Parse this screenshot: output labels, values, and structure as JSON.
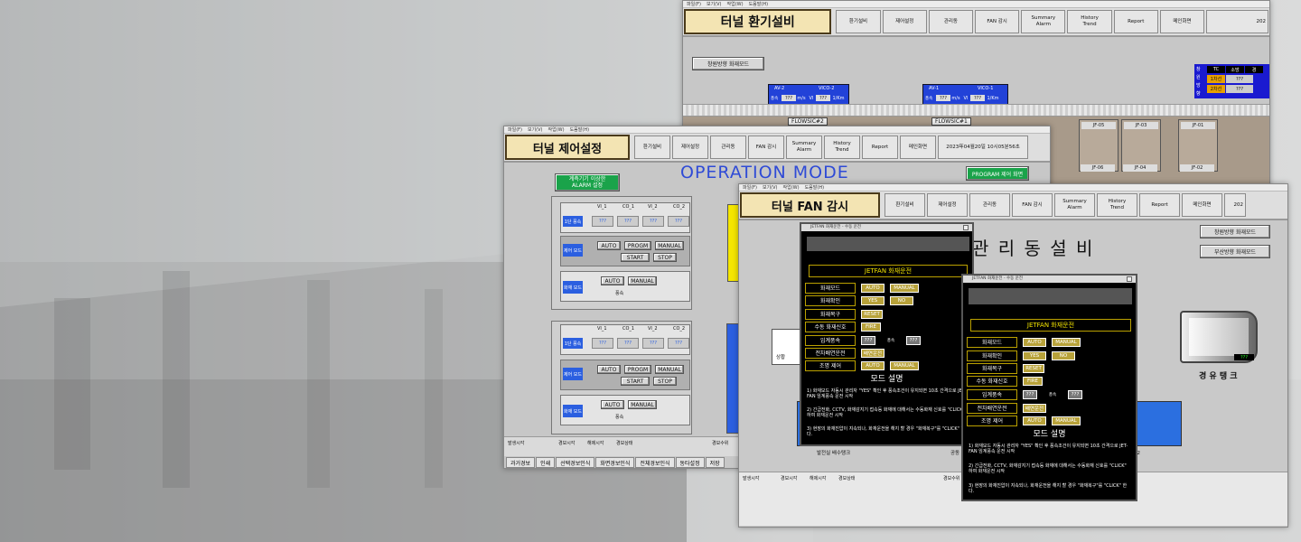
{
  "menu": [
    "파일(F)",
    "보기(V)",
    "작업(W)",
    "도움말(H)"
  ],
  "nav": {
    "items": [
      "환기설비",
      "제어설정",
      "관리동",
      "FAN 감시",
      "Summary\nAlarm",
      "History\nTrend",
      "Report",
      "메인화면"
    ]
  },
  "win_ventilation": {
    "title": "터널 환기설비",
    "clock": "202",
    "fire_mode_btn": "창원방향 화재모드",
    "flow1": "FLOWSIC#2",
    "flow2": "FLOWSIC#1",
    "av1": {
      "name": "AV-2",
      "vico": "VICO-2",
      "vals": [
        "???",
        "m/s",
        "VI",
        "???",
        "1/Km",
        "CO",
        "???",
        "ppm"
      ],
      "labels": [
        "풍속",
        "풍향"
      ]
    },
    "av2": {
      "name": "AV-1",
      "vico": "VICO-1",
      "vals": [
        "???",
        "m/s",
        "VI",
        "???",
        "1/Km",
        "CO",
        "???",
        "ppm"
      ],
      "labels": [
        "풍속",
        "풍향"
      ]
    },
    "side_table": {
      "label": "창원방향",
      "headers": [
        "TC",
        "소방",
        "경"
      ],
      "rows": [
        [
          "1차선",
          "???"
        ],
        [
          "2차선",
          "???"
        ]
      ]
    },
    "fans": [
      "JF-05",
      "JF-03",
      "JF-01",
      "JF-06",
      "JF-04",
      "JF-02"
    ]
  },
  "win_control": {
    "title": "터널 제어설정",
    "clock": "2023年04월20일 10시05분56초",
    "heading": "OPERATION MODE",
    "program_btn": "PROGRAM 제어 화면",
    "alarm_btn": "계측기기 이상한\nALARM 설정",
    "group1": {
      "cols": [
        "VI_1",
        "CO_1",
        "VI_2",
        "CO_2"
      ],
      "cells": [
        "???",
        "???",
        "???",
        "???"
      ],
      "row_label": "1단 풍속",
      "ctrl_label": "제어 모드",
      "ctrl_btns": [
        "AUTO",
        "PROGM",
        "MANUAL"
      ],
      "ctrl_btns2": [
        "START",
        "STOP"
      ],
      "fan_label": "화재 모드",
      "fan_btns": [
        "AUTO",
        "MANUAL"
      ],
      "fan_step": "풍속"
    },
    "group2": {
      "cols": [
        "VI_1",
        "CO_1",
        "VI_2",
        "CO_2"
      ],
      "cells": [
        "???",
        "???",
        "???",
        "???"
      ],
      "row_label": "1단 풍속",
      "ctrl_label": "제어 모드",
      "ctrl_btns": [
        "AUTO",
        "PROGM",
        "MANUAL"
      ],
      "ctrl_btns2": [
        "START",
        "STOP"
      ],
      "fan_label": "화재 모드",
      "fan_btns": [
        "AUTO",
        "MANUAL"
      ],
      "fan_step": "풍속"
    },
    "status_cols": [
      "발생시각",
      "경보시각",
      "해제시각",
      "경보상태",
      "경보수위"
    ],
    "tabs": [
      "과거경보",
      "인쇄",
      "선택경보인식",
      "화면경보인식",
      "전체경보인식",
      "동타설정",
      "저장"
    ]
  },
  "win_fan": {
    "title": "터널 FAN 감시",
    "clock": "202",
    "heading": "관 리 동 설 비",
    "btn_a": "창원방향 화재모드",
    "btn_b": "부산방향 화재모드",
    "tank_label": "경 유 탱 크",
    "tank_value": "???",
    "pump_label": "발전실 배수탱크",
    "pump_label2": "공동",
    "status_cols": [
      "발생시각",
      "경보시각",
      "해제시각",
      "경보상태",
      "경보수위"
    ],
    "right_label": "크 - 2",
    "left_tag": "상황"
  },
  "dialog1": {
    "title": "JETFAN 화재운전 - 수동 운전",
    "heading": "JETFAN 화재운전",
    "rows": [
      {
        "label": "화재모드",
        "btns": [
          "AUTO",
          "MANUAL"
        ]
      },
      {
        "label": "화재확인",
        "btns": [
          "YES",
          "NO"
        ]
      },
      {
        "label": "화재복구",
        "btns": [
          "RESET"
        ]
      },
      {
        "label": "수동 화재신호",
        "btns": [
          "FIRE"
        ]
      },
      {
        "label": "임계풍속",
        "btns": [
          "???",
          "풍속",
          "???"
        ]
      },
      {
        "label": "전차배연운전",
        "btns": [
          "배연운전"
        ]
      },
      {
        "label": "조명 제어",
        "btns": [
          "AUTO",
          "MANUAL"
        ]
      }
    ],
    "mode_heading": "모드 설명",
    "desc": [
      "1) 화재모드 자동시 관리자 \"YES\" 확인 후 풍속조건이 유지되면 10초 간격으로 JET-FAN 임계풍속 운전 시작",
      "2) 긴급전화, CCTV, 화재감지기 접속등 화재에 대해서는 수동화재 신호를 \"CLICK\" 하여 화재운전 시작",
      "3) 현장의 화재진압이 지속되나, 화재운전을 해지 할 경우 \"화재복구\"를 \"CLICK\" 한다."
    ]
  },
  "dialog2": {
    "title": "JETFAN 화재운전 - 수동 운전",
    "heading": "JETFAN 화재운전",
    "rows": [
      {
        "label": "화재모드",
        "btns": [
          "AUTO",
          "MANUAL"
        ]
      },
      {
        "label": "화재확인",
        "btns": [
          "YES",
          "NO"
        ]
      },
      {
        "label": "화재복구",
        "btns": [
          "RESET"
        ]
      },
      {
        "label": "수동 화재신호",
        "btns": [
          "FIRE"
        ]
      },
      {
        "label": "임계풍속",
        "btns": [
          "???",
          "풍속",
          "???"
        ]
      },
      {
        "label": "전차배연운전",
        "btns": [
          "배연운전"
        ]
      },
      {
        "label": "조명 제어",
        "btns": [
          "AUTO",
          "MANUAL"
        ]
      }
    ],
    "mode_heading": "모드 설명",
    "desc": [
      "1) 화재모드 자동시 관리자 \"YES\" 확인 후 풍속조건이 유지되면 10초 간격으로 JET-FAN 임계풍속 운전 시작",
      "2) 긴급전화, CCTV, 화재감지기 접속등 화재에 대해서는 수동화재 신호를 \"CLICK\" 하여 화재운전 시작",
      "3) 현장의 화재진압이 지속되나, 화재운전을 해지 할 경우 \"화재복구\"를 \"CLICK\" 한다."
    ]
  },
  "colors": {
    "title_bg": "#f3e4b3",
    "blue_heading": "#2f4bd6",
    "green_btn": "#1aa34a",
    "blue_chip": "#2b5fe0",
    "yellow": "#f5e600",
    "dialog_btn": "#b8a23a"
  }
}
